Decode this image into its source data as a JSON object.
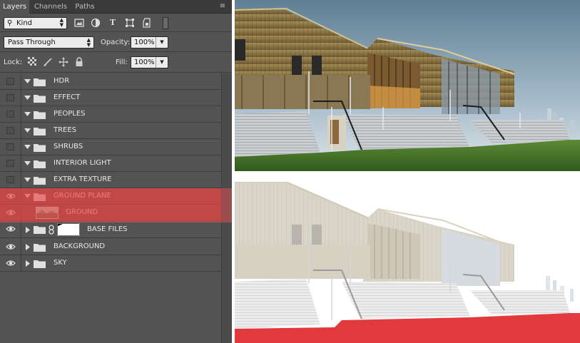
{
  "panel": {
    "tabs": [
      {
        "label": "Layers",
        "active": true
      },
      {
        "label": "Channels",
        "active": false
      },
      {
        "label": "Paths",
        "active": false
      }
    ],
    "menu_icon": "panel-menu-icon",
    "filter": {
      "kind_label": "Kind",
      "icons": [
        "image-filter-icon",
        "adjustment-filter-icon",
        "type-filter-icon",
        "shape-filter-icon",
        "smart-object-filter-icon"
      ]
    },
    "blend_mode": "Pass Through",
    "opacity_label": "Opacity:",
    "opacity_value": "100%",
    "lock_label": "Lock:",
    "lock_icons": [
      "lock-transparent-icon",
      "lock-image-icon",
      "lock-position-icon",
      "lock-all-icon"
    ],
    "fill_label": "Fill:",
    "fill_value": "100%"
  },
  "layers": [
    {
      "name": "HDR",
      "type": "group",
      "visible": false,
      "expanded": true
    },
    {
      "name": "EFFECT",
      "type": "group",
      "visible": false,
      "expanded": true
    },
    {
      "name": "PEOPLES",
      "type": "group",
      "visible": false,
      "expanded": true
    },
    {
      "name": "TREES",
      "type": "group",
      "visible": false,
      "expanded": true
    },
    {
      "name": "SHRUBS",
      "type": "group",
      "visible": false,
      "expanded": true
    },
    {
      "name": "INTERIOR LIGHT",
      "type": "group",
      "visible": false,
      "expanded": true
    },
    {
      "name": "EXTRA TEXTURE",
      "type": "group",
      "visible": false,
      "expanded": true
    },
    {
      "name": "GROUND PLANE",
      "type": "group",
      "visible": true,
      "expanded": true,
      "selected": true
    },
    {
      "name": "GROUND",
      "type": "layer",
      "visible": true,
      "selected": true
    },
    {
      "name": "BASE FILES",
      "type": "group",
      "visible": true,
      "expanded": false,
      "has_mask": true
    },
    {
      "name": "BACKGROUND",
      "type": "group",
      "visible": true,
      "expanded": false
    },
    {
      "name": "SKY",
      "type": "group",
      "visible": true,
      "expanded": false
    }
  ],
  "colors": {
    "panel_bg": "#535353",
    "selection": "#e25050",
    "ground_plane_fill": "#e2393c",
    "grass": "#3f6d25",
    "sky": "#7fa1b6"
  }
}
